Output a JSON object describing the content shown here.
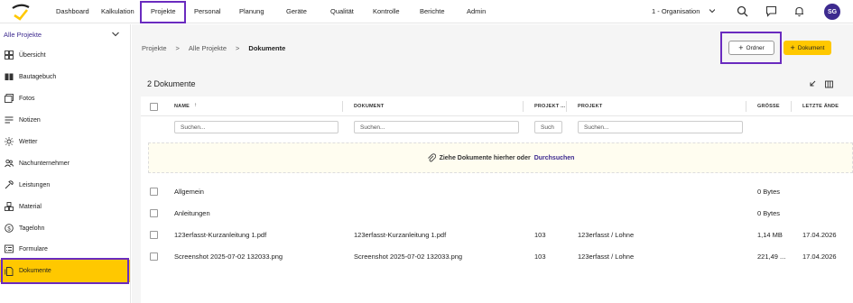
{
  "nav": {
    "items": [
      "Dashboard",
      "Kalkulation",
      "Projekte",
      "Personal",
      "Planung",
      "Geräte",
      "Qualität",
      "Kontrolle",
      "Berichte",
      "Admin"
    ],
    "organisation": "1 - Organisation",
    "avatar_initials": "SG"
  },
  "sidebar": {
    "project_select": "Alle Projekte",
    "items": [
      {
        "label": "Übersicht",
        "icon": "dashboard-icon"
      },
      {
        "label": "Bautagebuch",
        "icon": "book-icon"
      },
      {
        "label": "Fotos",
        "icon": "photo-icon"
      },
      {
        "label": "Notizen",
        "icon": "notes-icon"
      },
      {
        "label": "Wetter",
        "icon": "sun-icon"
      },
      {
        "label": "Nachunternehmer",
        "icon": "people-icon"
      },
      {
        "label": "Leistungen",
        "icon": "tools-icon"
      },
      {
        "label": "Material",
        "icon": "material-icon"
      },
      {
        "label": "Tagelohn",
        "icon": "money-icon"
      },
      {
        "label": "Formulare",
        "icon": "form-icon"
      },
      {
        "label": "Dokumente",
        "icon": "document-icon"
      }
    ]
  },
  "breadcrumb": [
    "Projekte",
    "Alle Projekte",
    "Dokumente"
  ],
  "buttons": {
    "ordner": "Ordner",
    "dokument": "Dokument"
  },
  "count_title": "2 Dokumente",
  "table": {
    "headers": [
      "NAME",
      "DOKUMENT",
      "PROJEKT ...",
      "PROJEKT",
      "GRÖSSE",
      "LETZTE ÄNDE"
    ],
    "filters": [
      "Suchen...",
      "Suchen...",
      "Such",
      "Suchen..."
    ],
    "drop_text": "Ziehe Dokumente hierher oder",
    "drop_link": "Durchsuchen",
    "rows": [
      {
        "name": "Allgemein",
        "dokument": "",
        "projekt_nr": "",
        "projekt": "",
        "groesse": "0 Bytes",
        "datum": ""
      },
      {
        "name": "Anleitungen",
        "dokument": "",
        "projekt_nr": "",
        "projekt": "",
        "groesse": "0 Bytes",
        "datum": ""
      },
      {
        "name": "123erfasst-Kurzanleitung 1.pdf",
        "dokument": "123erfasst-Kurzanleitung 1.pdf",
        "projekt_nr": "103",
        "projekt": "123erfasst / Lohne",
        "groesse": "1,14 MB",
        "datum": "17.04.2026"
      },
      {
        "name": "Screenshot 2025-07-02 132033.png",
        "dokument": "Screenshot 2025-07-02 132033.png",
        "projekt_nr": "103",
        "projekt": "123erfasst / Lohne",
        "groesse": "221,49 ...",
        "datum": "17.04.2026"
      }
    ]
  },
  "colors": {
    "accent": "#ffc800",
    "brand": "#3d2a8f",
    "highlight": "#6a2bbf"
  }
}
